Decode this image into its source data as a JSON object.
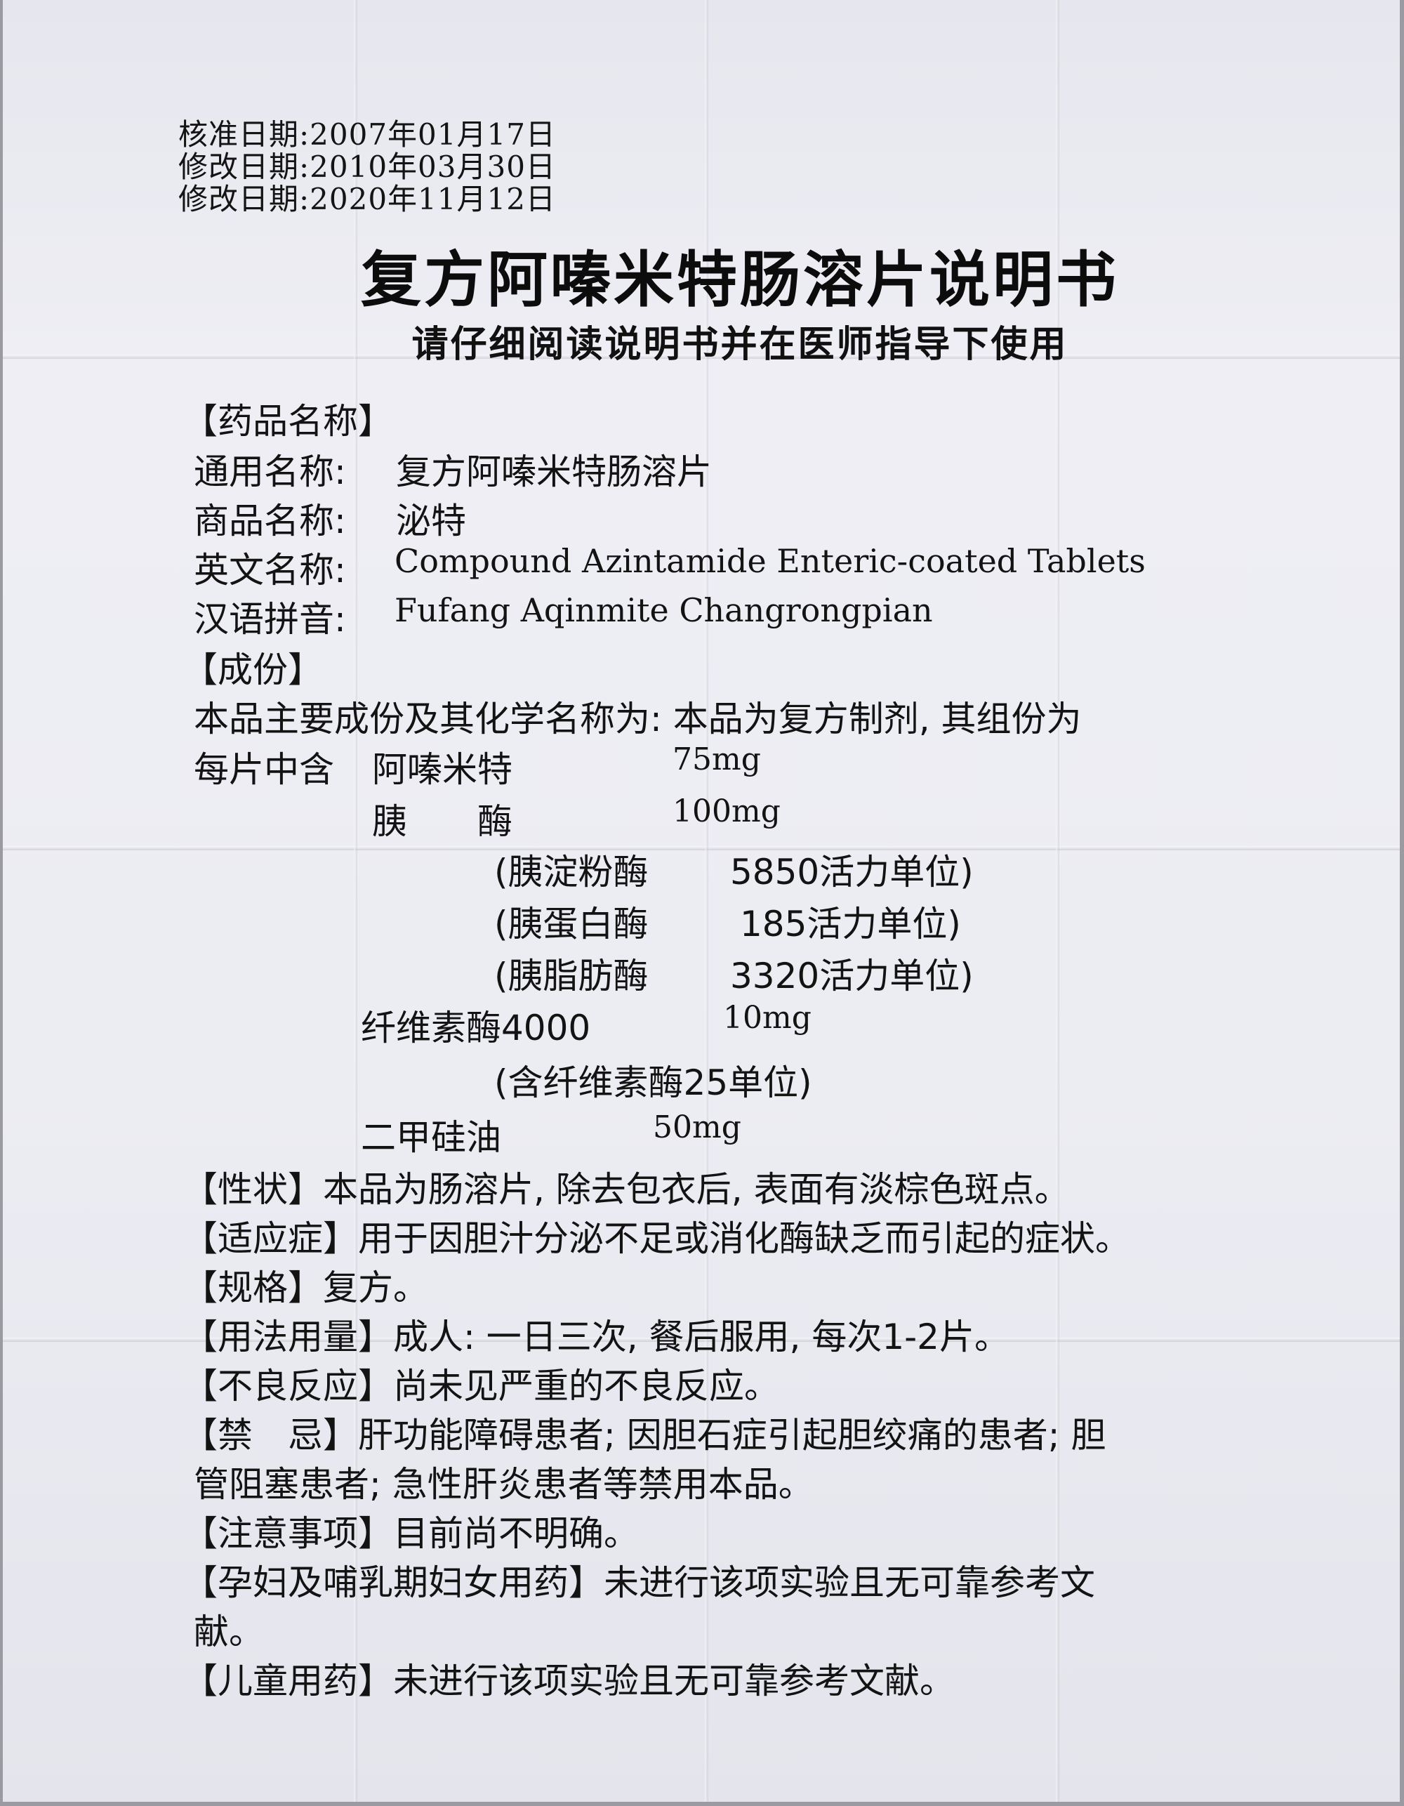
{
  "header": {
    "approval_date": "核准日期:2007年01月17日",
    "revision_date_1": "修改日期:2010年03月30日",
    "revision_date_2": "修改日期:2020年11月12日"
  },
  "title": "复方阿嗪米特肠溶片说明书",
  "subtitle": "请仔细阅读说明书并在医师指导下使用",
  "drug_name": {
    "heading": "【药品名称】",
    "generic_label": "通用名称:",
    "generic_value": "复方阿嗪米特肠溶片",
    "trade_label": "商品名称:",
    "trade_value": "泌特",
    "english_label": "英文名称:",
    "english_value": "Compound Azintamide Enteric-coated Tablets",
    "pinyin_label": "汉语拼音:",
    "pinyin_value": "Fufang Aqinmite Changrongpian"
  },
  "ingredients": {
    "heading": "【成份】",
    "intro": "本品主要成份及其化学名称为: 本品为复方制剂, 其组份为",
    "prefix": "每片中含",
    "items": [
      {
        "name": "阿嗪米特",
        "amount": "75mg"
      },
      {
        "name": "胰　　酶",
        "amount": "100mg"
      },
      {
        "name": "(胰淀粉酶",
        "amount": "5850活力单位)"
      },
      {
        "name": "(胰蛋白酶",
        "amount": "185活力单位)"
      },
      {
        "name": "(胰脂肪酶",
        "amount": "3320活力单位)"
      },
      {
        "name": "纤维素酶4000",
        "amount": "10mg"
      },
      {
        "name": "(含纤维素酶25单位)",
        "amount": ""
      },
      {
        "name": "二甲硅油",
        "amount": "50mg"
      }
    ]
  },
  "sections": {
    "appearance": "【性状】本品为肠溶片, 除去包衣后, 表面有淡棕色斑点。",
    "indications": "【适应症】用于因胆汁分泌不足或消化酶缺乏而引起的症状。",
    "specification": "【规格】复方。",
    "dosage": "【用法用量】成人: 一日三次, 餐后服用, 每次1-2片。",
    "adverse": "【不良反应】尚未见严重的不良反应。",
    "contraindications_1": "【禁　忌】肝功能障碍患者; 因胆石症引起胆绞痛的患者; 胆",
    "contraindications_2": "管阻塞患者; 急性肝炎患者等禁用本品。",
    "precautions": "【注意事项】目前尚不明确。",
    "pregnancy_1": "【孕妇及哺乳期妇女用药】未进行该项实验且无可靠参考文",
    "pregnancy_2": "献。",
    "children": "【儿童用药】未进行该项实验且无可靠参考文献。"
  }
}
